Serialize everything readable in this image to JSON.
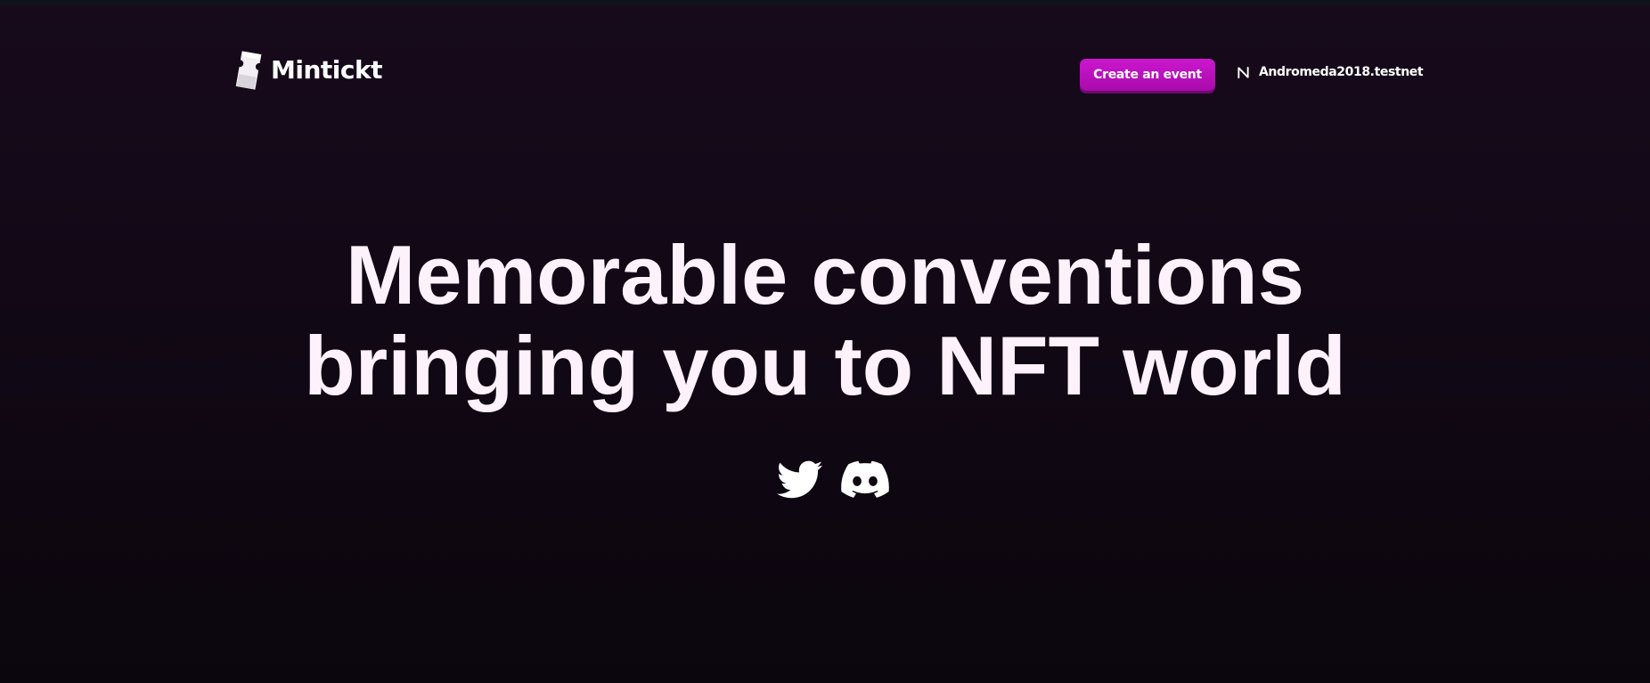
{
  "header": {
    "logo_text": "Mintickt",
    "create_event_label": "Create an event",
    "account_name": "Andromeda2018.testnet"
  },
  "hero": {
    "title_line1": "Memorable conventions",
    "title_line2": "bringing you to NFT world"
  },
  "socials": {
    "icons": [
      "twitter-icon",
      "discord-icon"
    ]
  },
  "colors": {
    "background": "#120816",
    "accent": "#c113c4",
    "text": "#ffffff",
    "hero_text": "#fdf2fb"
  }
}
